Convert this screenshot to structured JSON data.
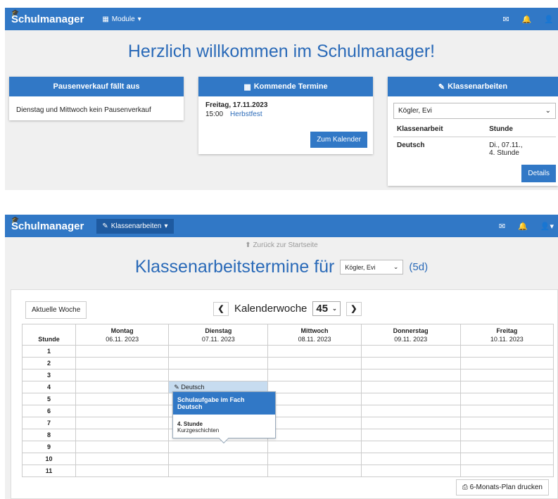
{
  "nav1": {
    "brand": "Schulmanager",
    "module_label": "Module",
    "icons": [
      "envelope-icon",
      "bell-icon",
      "user-icon"
    ]
  },
  "home": {
    "welcome": "Herzlich willkommen im Schulmanager!",
    "card1": {
      "title": "Pausenverkauf fällt aus",
      "text": "Dienstag und Mittwoch kein Pausenverkauf"
    },
    "card2": {
      "title": "Kommende Termine",
      "date": "Freitag, 17.11.2023",
      "time": "15:00",
      "event": "Herbstfest",
      "button": "Zum Kalender"
    },
    "card3": {
      "title": "Klassenarbeiten",
      "select": "Kögler, Evi",
      "col1": "Klassenarbeit",
      "col2": "Stunde",
      "subject": "Deutsch",
      "when1": "Di., 07.11.,",
      "when2": "4. Stunde",
      "button": "Details"
    }
  },
  "nav2": {
    "brand": "Schulmanager",
    "module_label": "Klassenarbeiten"
  },
  "page": {
    "back": "Zurück zur Startseite",
    "title": "Klassenarbeitstermine für",
    "student": "Kögler, Evi",
    "suffix": "(5d)",
    "current_week": "Aktuelle Woche",
    "week_label": "Kalenderwoche",
    "week_number": "45",
    "print": "6-Monats-Plan drucken"
  },
  "grid": {
    "stunde_label": "Stunde",
    "days": [
      {
        "name": "Montag",
        "date": "06.11. 2023"
      },
      {
        "name": "Dienstag",
        "date": "07.11. 2023"
      },
      {
        "name": "Mittwoch",
        "date": "08.11. 2023"
      },
      {
        "name": "Donnerstag",
        "date": "09.11. 2023"
      },
      {
        "name": "Freitag",
        "date": "10.11. 2023"
      }
    ],
    "hours": [
      "1",
      "2",
      "3",
      "4",
      "5",
      "6",
      "7",
      "8",
      "9",
      "10",
      "11"
    ],
    "entry": {
      "label": "Deutsch"
    }
  },
  "tooltip": {
    "title": "Schulaufgabe im Fach Deutsch",
    "hour": "4. Stunde",
    "topic": "Kurzgeschichten"
  },
  "colors": {
    "primary": "#3178c6",
    "heading": "#2a6ab8",
    "highlight": "#c7dcf0",
    "background": "#f0f0f0"
  }
}
